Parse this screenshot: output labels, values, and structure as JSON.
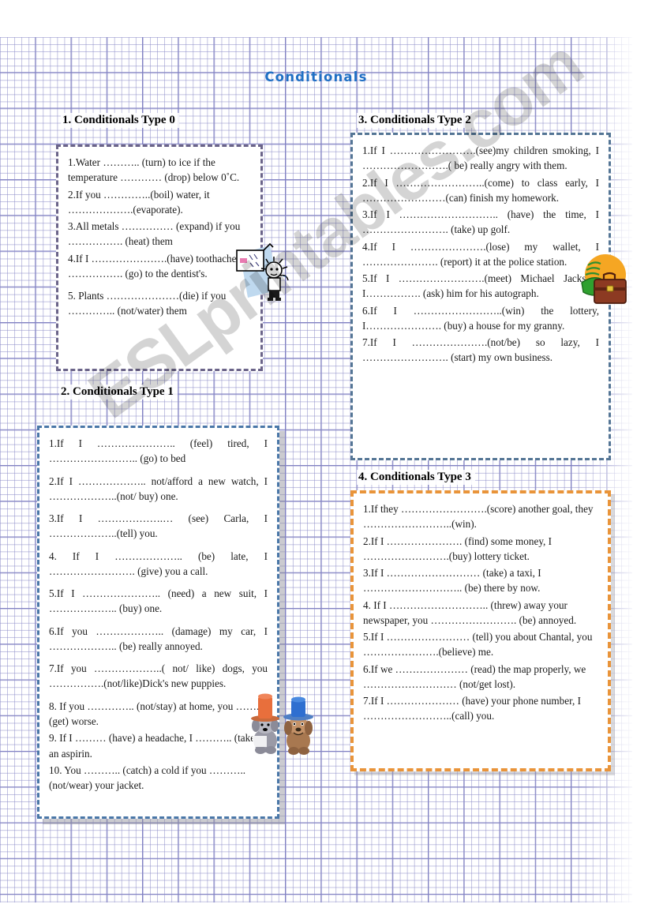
{
  "title": "Conditionals",
  "watermark": "ESLprintables.com",
  "colors": {
    "title": "#1f6fc4",
    "box1_border": "#6b6489",
    "box2_border": "#4a77a8",
    "box3_border": "#547595",
    "box4_border": "#e9943a",
    "grid": "#7878be"
  },
  "sections": [
    {
      "heading": "1. Conditionals Type 0",
      "items": [
        "1.Water ……….. (turn) to ice if the temperature ………… (drop) below 0˚C.",
        "2.If you …………..(boil) water, it ……………….(evaporate).",
        "3.All metals …………… (expand) if you ……………. (heat) them",
        "4.If I ………………….(have) toothache, I ……………. (go) to the dentist's.",
        "5. Plants …………………(die) if you ………….. (not/water) them"
      ]
    },
    {
      "heading": "2. Conditionals Type 1",
      "items": [
        "1.If   I   …………………..   (feel)   tired,   I …………………….. (go) to bed",
        "2.If I ……………….. not/afford a new watch, I ………………..(not/ buy) one.",
        "3.If I ……………….…   (see) Carla, I ………………..(tell) you.",
        "4.   If   I   ………………..   (be)   late,   I ……………………. (give) you a call.",
        "5.If I ………………….. (need) a new suit, I ……………….. (buy) one.",
        "6.If you ……………….. (damage) my car, I ……………….. (be) really annoyed.",
        "7.If you ………………..( not/ like) dogs, you        …………….(not/like)Dick's      new puppies.",
        "  8. If you ………….. (not/stay) at home, you …….. (get) worse.",
        "  9. If I ……… (have) a headache, I ……….. (take) an aspirin.",
        "10. You ……….. (catch) a cold if you ……….. (not/wear) your jacket."
      ]
    },
    {
      "heading": "3. Conditionals Type 2",
      "items": [
        "1.If I …………………….(see)my children smoking, I …………………….( be) really angry with them.",
        "2.If I ……………………..(come) to class early, I ……………………(can) finish my homework.",
        "3.If I ……………………….. (have) the time, I ……………………. (take) up golf.",
        "4.If I ………………….(lose) my wallet, I …………………. (report) it at the police station.",
        "5.If I …………………….(meet) Michael Jackson, I……………. (ask) him for his autograph.",
        "6.If I ……………………..(win) the lottery, I…………………. (buy) a house for my granny.",
        "7.If I ………………….(not/be) so lazy, I ……………………. (start) my own business."
      ]
    },
    {
      "heading": "4. Conditionals Type 3",
      "items": [
        "1.If they …………………….(score) another goal, they ……………………..(win).",
        "2.If I …………………. (find) some money, I …………………….(buy) lottery ticket.",
        "3.If I ……………………… (take) a taxi, I ……………………….. (be) there by now.",
        "4. If I ……………………….. (threw) away your newspaper, you ……………………. (be) annoyed.",
        "5.If I …………………… (tell)  you about Chantal, you ………………….(believe) me.",
        "6.If we ………………… (read) the map properly, we ……………………… (not/get lost).",
        "7.If I  ………………… (have) your phone number, I ……………………..(call) you."
      ]
    }
  ],
  "clipart": [
    {
      "name": "dentist-toothache-clipart"
    },
    {
      "name": "dogs-with-hats-clipart"
    },
    {
      "name": "money-briefcase-clipart"
    }
  ]
}
